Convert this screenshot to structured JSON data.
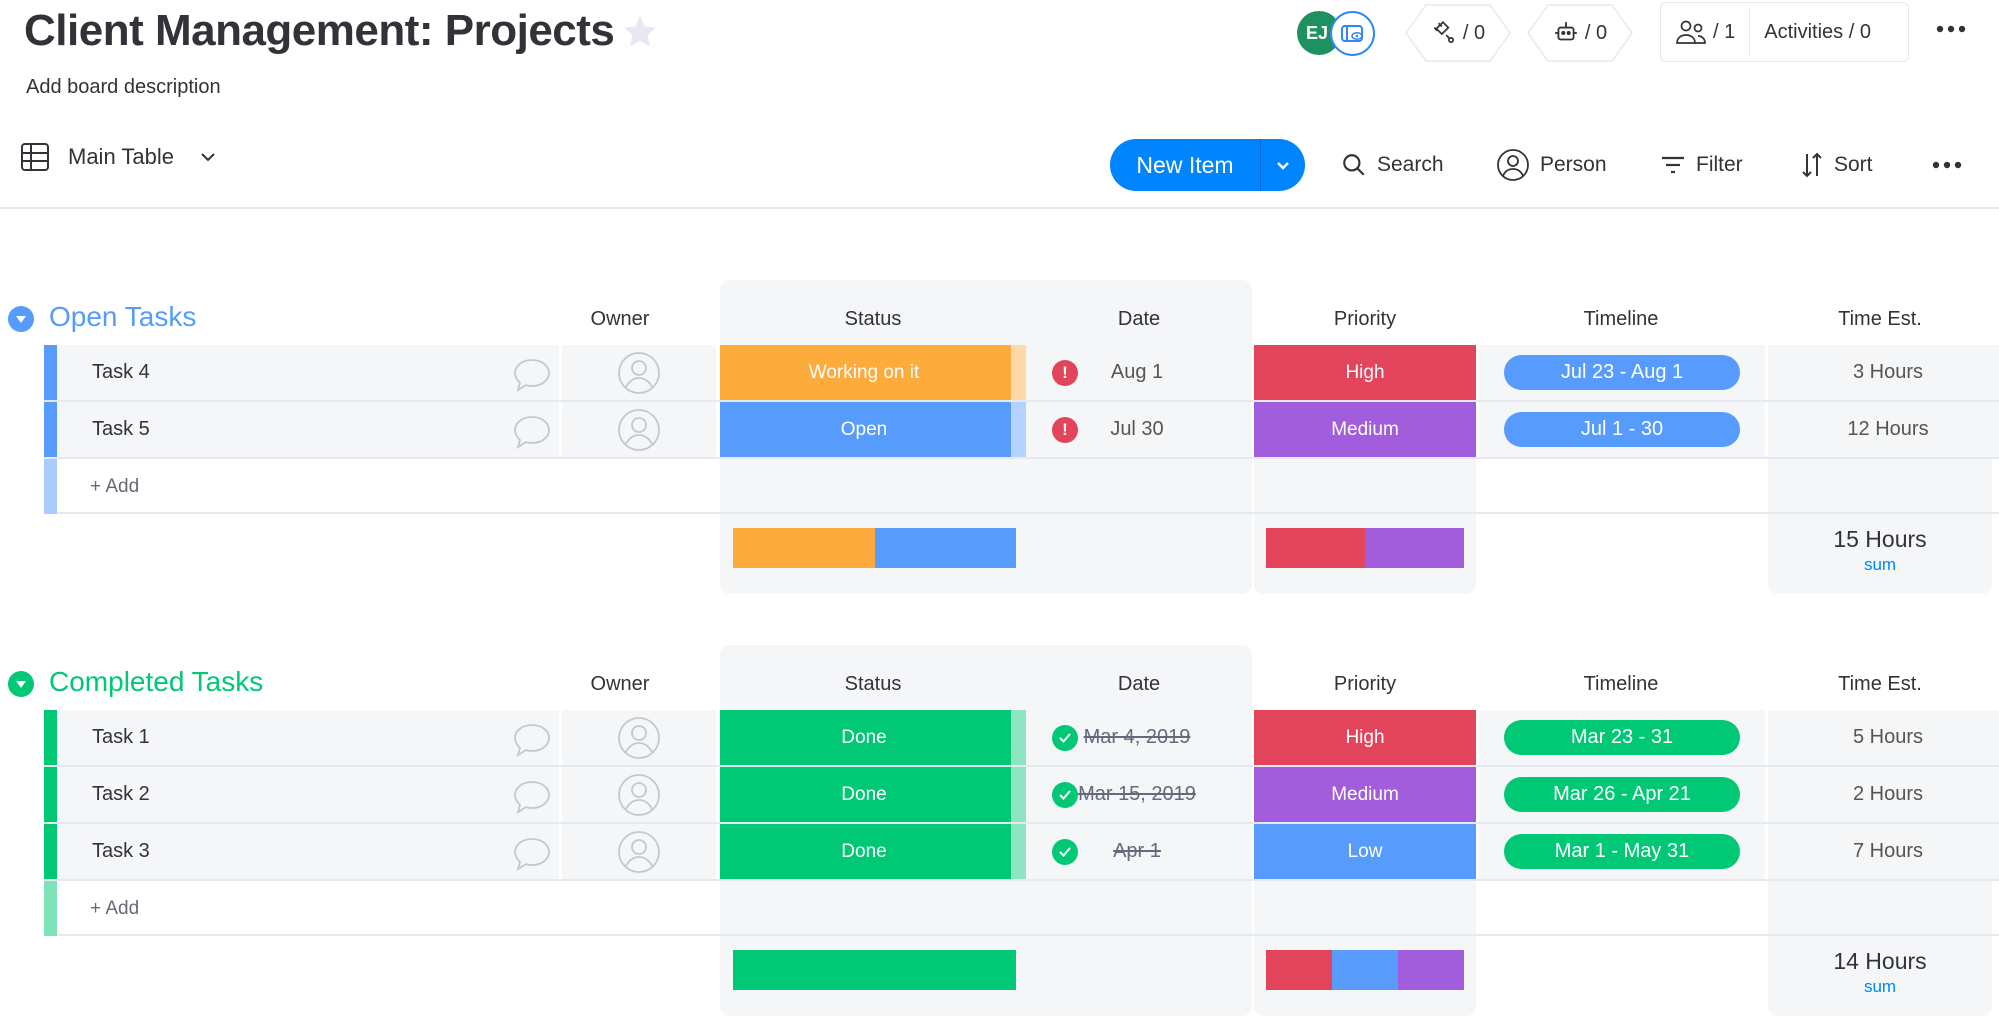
{
  "board": {
    "title": "Client Management: Projects",
    "description": "Add board description"
  },
  "header": {
    "avatar_initials": "EJ",
    "integrations_count": "/ 0",
    "automations_count": "/ 0",
    "members_count": "/ 1",
    "activities_label": "Activities / 0"
  },
  "toolbar": {
    "view_label": "Main Table",
    "new_item_label": "New Item",
    "search_label": "Search",
    "person_label": "Person",
    "filter_label": "Filter",
    "sort_label": "Sort"
  },
  "columns": {
    "owner": "Owner",
    "status": "Status",
    "date": "Date",
    "priority": "Priority",
    "timeline": "Timeline",
    "time_est": "Time Est."
  },
  "colors": {
    "open_group": "#579bfc",
    "completed_group": "#00c875",
    "working": "#fdab3d",
    "open": "#579bfc",
    "done": "#00c875",
    "high": "#e2445c",
    "medium": "#a25ddc",
    "low": "#579bfc",
    "alert": "#e2445c",
    "sum_label": "#0085ff"
  },
  "groups": [
    {
      "title": "Open Tasks",
      "color": "#579bfc",
      "add_label": "+ Add",
      "rows": [
        {
          "name": "Task 4",
          "status": "Working on it",
          "status_color": "#fdab3d",
          "date_icon": "alert",
          "date": "Aug 1",
          "date_done": false,
          "priority": "High",
          "priority_color": "#e2445c",
          "timeline": "Jul 23 - Aug 1",
          "time_est": "3 Hours"
        },
        {
          "name": "Task 5",
          "status": "Open",
          "status_color": "#579bfc",
          "date_icon": "alert",
          "date": "Jul 30",
          "date_done": false,
          "priority": "Medium",
          "priority_color": "#a25ddc",
          "timeline": "Jul 1 - 30",
          "time_est": "12 Hours"
        }
      ],
      "summary": {
        "status_dist": [
          {
            "color": "#fdab3d",
            "share": 0.5
          },
          {
            "color": "#579bfc",
            "share": 0.5
          }
        ],
        "priority_dist": [
          {
            "color": "#e2445c",
            "share": 0.5
          },
          {
            "color": "#a25ddc",
            "share": 0.5
          }
        ],
        "time_total": "15 Hours",
        "time_label": "sum"
      }
    },
    {
      "title": "Completed Tasks",
      "color": "#00c875",
      "add_label": "+ Add",
      "rows": [
        {
          "name": "Task 1",
          "status": "Done",
          "status_color": "#00c875",
          "date_icon": "check",
          "date": "Mar 4, 2019",
          "date_done": true,
          "priority": "High",
          "priority_color": "#e2445c",
          "timeline": "Mar 23 - 31",
          "time_est": "5 Hours"
        },
        {
          "name": "Task 2",
          "status": "Done",
          "status_color": "#00c875",
          "date_icon": "check",
          "date": "Mar 15, 2019",
          "date_done": true,
          "priority": "Medium",
          "priority_color": "#a25ddc",
          "timeline": "Mar 26 - Apr 21",
          "time_est": "2 Hours"
        },
        {
          "name": "Task 3",
          "status": "Done",
          "status_color": "#00c875",
          "date_icon": "check",
          "date": "Apr 1",
          "date_done": true,
          "priority": "Low",
          "priority_color": "#579bfc",
          "timeline": "Mar 1 - May 31",
          "time_est": "7 Hours"
        }
      ],
      "summary": {
        "status_dist": [
          {
            "color": "#00c875",
            "share": 1.0
          }
        ],
        "priority_dist": [
          {
            "color": "#e2445c",
            "share": 0.333
          },
          {
            "color": "#579bfc",
            "share": 0.334
          },
          {
            "color": "#a25ddc",
            "share": 0.333
          }
        ],
        "time_total": "14 Hours",
        "time_label": "sum"
      }
    }
  ]
}
